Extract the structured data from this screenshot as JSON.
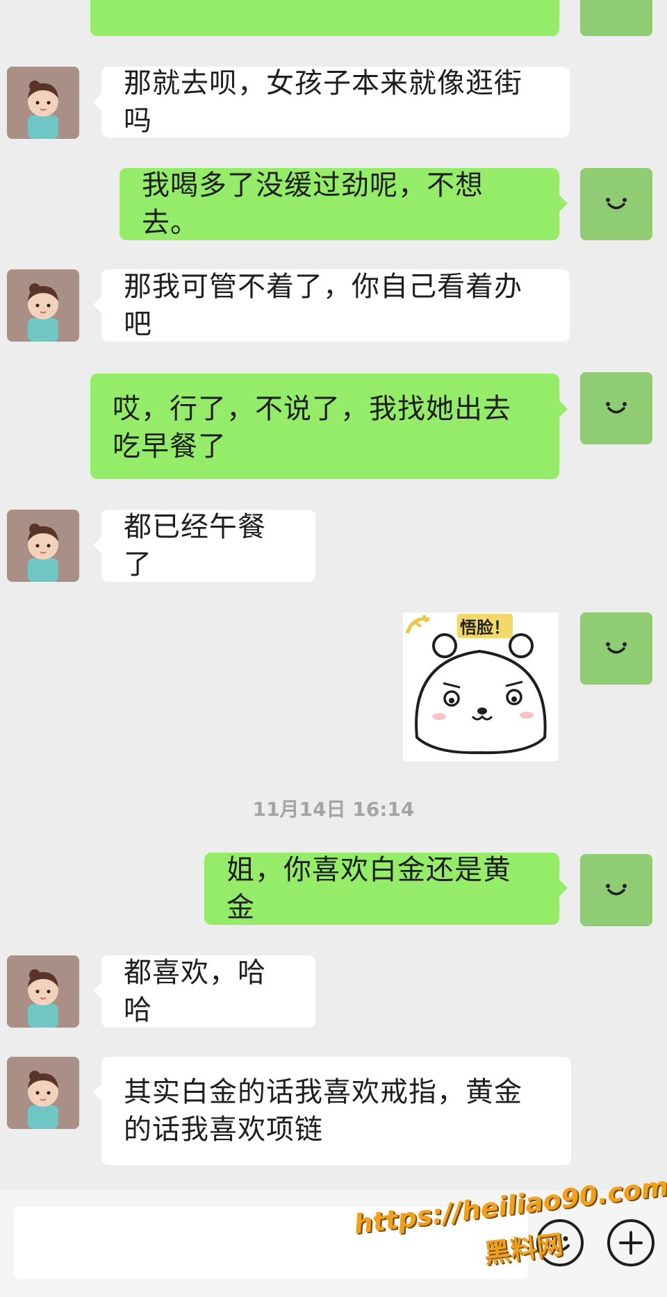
{
  "chat": {
    "messages": [
      {
        "id": 1,
        "from": "her",
        "text": "那就去呗，女孩子本来就像逛街吗"
      },
      {
        "id": 2,
        "from": "me",
        "text": "我喝多了没缓过劲呢，不想去。"
      },
      {
        "id": 3,
        "from": "her",
        "text": "那我可管不着了，你自己看着办吧"
      },
      {
        "id": 4,
        "from": "me",
        "text": "哎，行了，不说了，我找她出去吃早餐了"
      },
      {
        "id": 5,
        "from": "her",
        "text": "都已经午餐了"
      },
      {
        "id": 6,
        "from": "me",
        "type": "sticker",
        "sticker_text": "悟脸！"
      },
      {
        "id": 7,
        "type": "timestamp",
        "text": "11月14日 16:14"
      },
      {
        "id": 8,
        "from": "me",
        "text": "姐，你喜欢白金还是黄金"
      },
      {
        "id": 9,
        "from": "her",
        "text": "都喜欢，哈哈"
      },
      {
        "id": 10,
        "from": "her",
        "text": "其实白金的话我喜欢戒指，黄金的话我喜欢项链"
      }
    ]
  },
  "input_bar": {
    "emoji_icon": "emoji-icon",
    "plus_icon": "plus-icon"
  },
  "watermark": {
    "url": "https://heiliao90.com",
    "name": "黑料网"
  },
  "colors": {
    "background": "#ededed",
    "incoming_bubble": "#ffffff",
    "outgoing_bubble": "#95ec69",
    "my_avatar": "#8fcc74",
    "watermark": "#f0a020"
  }
}
